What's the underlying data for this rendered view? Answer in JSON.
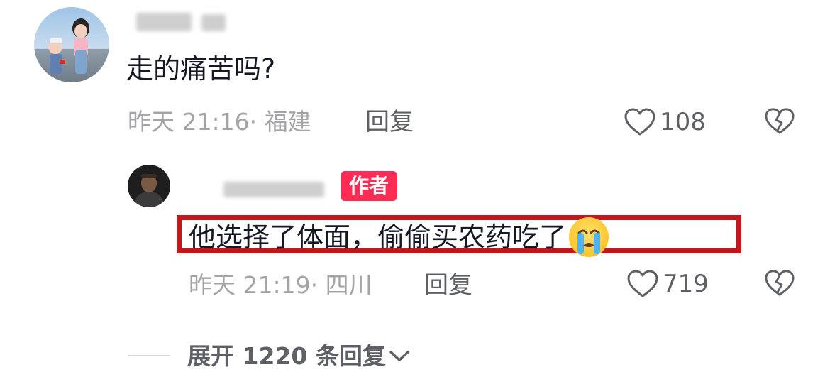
{
  "comment": {
    "text": "走的痛苦吗?",
    "time": "昨天 21:16",
    "location": "· 福建",
    "reply_label": "回复",
    "likes": "108"
  },
  "reply": {
    "author_badge": "作者",
    "text": "他选择了体面，偷偷买农药吃了",
    "emoji": "loudly-crying-face",
    "time": "昨天 21:19",
    "location": "· 四川",
    "reply_label": "回复",
    "likes": "719"
  },
  "expand": {
    "label": "展开 1220 条回复"
  },
  "colors": {
    "highlight_border": "#c3171c",
    "author_badge_bg": "#fe2c55",
    "meta_text": "#a3a3a8"
  }
}
